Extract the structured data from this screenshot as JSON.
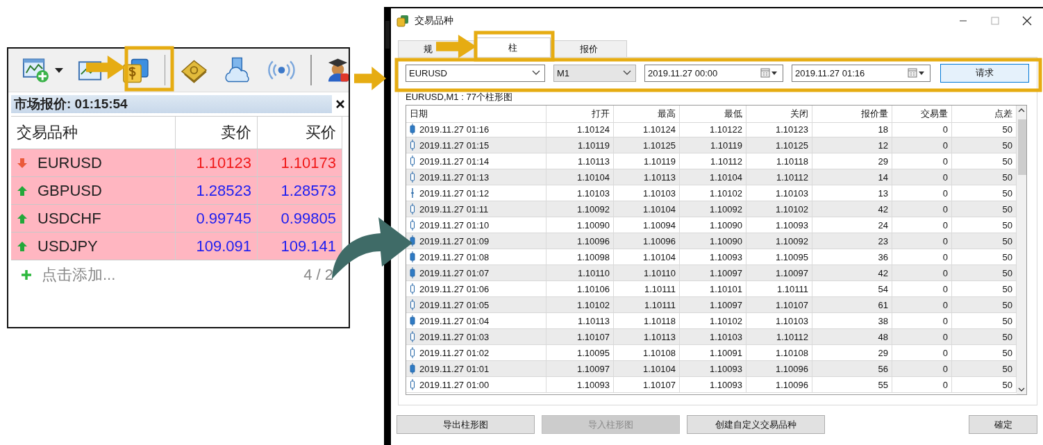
{
  "market_watch": {
    "title": "市场报价: 01:15:54",
    "columns": [
      "交易品种",
      "卖价",
      "买价"
    ],
    "rows": [
      {
        "symbol": "EURUSD",
        "kind": "down",
        "bid": "1.10123",
        "ask": "1.10173"
      },
      {
        "symbol": "GBPUSD",
        "kind": "up",
        "bid": "1.28523",
        "ask": "1.28573"
      },
      {
        "symbol": "USDCHF",
        "kind": "up",
        "bid": "0.99745",
        "ask": "0.99805"
      },
      {
        "symbol": "USDJPY",
        "kind": "up",
        "bid": "109.091",
        "ask": "109.141"
      }
    ],
    "add_label": "点击添加...",
    "count": "4 / 2"
  },
  "symbol_dialog": {
    "title": "交易品种",
    "tabs": [
      {
        "label": "规",
        "selected": false
      },
      {
        "label": "柱",
        "selected": true
      },
      {
        "label": "报价",
        "selected": false
      }
    ],
    "symbol": "EURUSD",
    "timeframe": "M1",
    "date_from": "2019.11.27 00:00",
    "date_to": "2019.11.27 01:16",
    "request_button": "请求",
    "summary": "EURUSD,M1 : 77个柱形图",
    "table": {
      "columns": [
        "日期",
        "打开",
        "最高",
        "最低",
        "关闭",
        "报价量",
        "交易量",
        "点差"
      ],
      "rows": [
        {
          "kind": "bear",
          "cells": [
            "2019.11.27 01:16",
            "1.10124",
            "1.10124",
            "1.10122",
            "1.10123",
            "18",
            "0",
            "50"
          ]
        },
        {
          "kind": "bull",
          "cells": [
            "2019.11.27 01:15",
            "1.10119",
            "1.10125",
            "1.10119",
            "1.10125",
            "12",
            "0",
            "50"
          ]
        },
        {
          "kind": "bull",
          "cells": [
            "2019.11.27 01:14",
            "1.10113",
            "1.10119",
            "1.10112",
            "1.10118",
            "29",
            "0",
            "50"
          ]
        },
        {
          "kind": "bull",
          "cells": [
            "2019.11.27 01:13",
            "1.10104",
            "1.10113",
            "1.10104",
            "1.10112",
            "14",
            "0",
            "50"
          ]
        },
        {
          "kind": "doji",
          "cells": [
            "2019.11.27 01:12",
            "1.10103",
            "1.10103",
            "1.10102",
            "1.10103",
            "13",
            "0",
            "50"
          ]
        },
        {
          "kind": "bull",
          "cells": [
            "2019.11.27 01:11",
            "1.10092",
            "1.10104",
            "1.10092",
            "1.10102",
            "42",
            "0",
            "50"
          ]
        },
        {
          "kind": "bull",
          "cells": [
            "2019.11.27 01:10",
            "1.10090",
            "1.10094",
            "1.10090",
            "1.10093",
            "24",
            "0",
            "50"
          ]
        },
        {
          "kind": "bear",
          "cells": [
            "2019.11.27 01:09",
            "1.10096",
            "1.10096",
            "1.10090",
            "1.10092",
            "23",
            "0",
            "50"
          ]
        },
        {
          "kind": "bear",
          "cells": [
            "2019.11.27 01:08",
            "1.10098",
            "1.10104",
            "1.10093",
            "1.10095",
            "36",
            "0",
            "50"
          ]
        },
        {
          "kind": "bear",
          "cells": [
            "2019.11.27 01:07",
            "1.10110",
            "1.10110",
            "1.10097",
            "1.10097",
            "42",
            "0",
            "50"
          ]
        },
        {
          "kind": "bull",
          "cells": [
            "2019.11.27 01:06",
            "1.10106",
            "1.10111",
            "1.10101",
            "1.10111",
            "54",
            "0",
            "50"
          ]
        },
        {
          "kind": "bull",
          "cells": [
            "2019.11.27 01:05",
            "1.10102",
            "1.10111",
            "1.10097",
            "1.10107",
            "61",
            "0",
            "50"
          ]
        },
        {
          "kind": "bear",
          "cells": [
            "2019.11.27 01:04",
            "1.10113",
            "1.10118",
            "1.10102",
            "1.10103",
            "38",
            "0",
            "50"
          ]
        },
        {
          "kind": "bull",
          "cells": [
            "2019.11.27 01:03",
            "1.10107",
            "1.10113",
            "1.10103",
            "1.10112",
            "48",
            "0",
            "50"
          ]
        },
        {
          "kind": "bull",
          "cells": [
            "2019.11.27 01:02",
            "1.10095",
            "1.10108",
            "1.10091",
            "1.10108",
            "29",
            "0",
            "50"
          ]
        },
        {
          "kind": "bear",
          "cells": [
            "2019.11.27 01:01",
            "1.10097",
            "1.10104",
            "1.10093",
            "1.10096",
            "56",
            "0",
            "50"
          ]
        },
        {
          "kind": "bull",
          "cells": [
            "2019.11.27 01:00",
            "1.10093",
            "1.10107",
            "1.10093",
            "1.10096",
            "55",
            "0",
            "50"
          ]
        }
      ]
    },
    "buttons": [
      {
        "label": "导出柱形图",
        "disabled": false
      },
      {
        "label": "导入柱形图",
        "disabled": true
      },
      {
        "label": "创建自定义交易品种",
        "disabled": false
      },
      {
        "label": "確定",
        "disabled": false
      }
    ]
  }
}
